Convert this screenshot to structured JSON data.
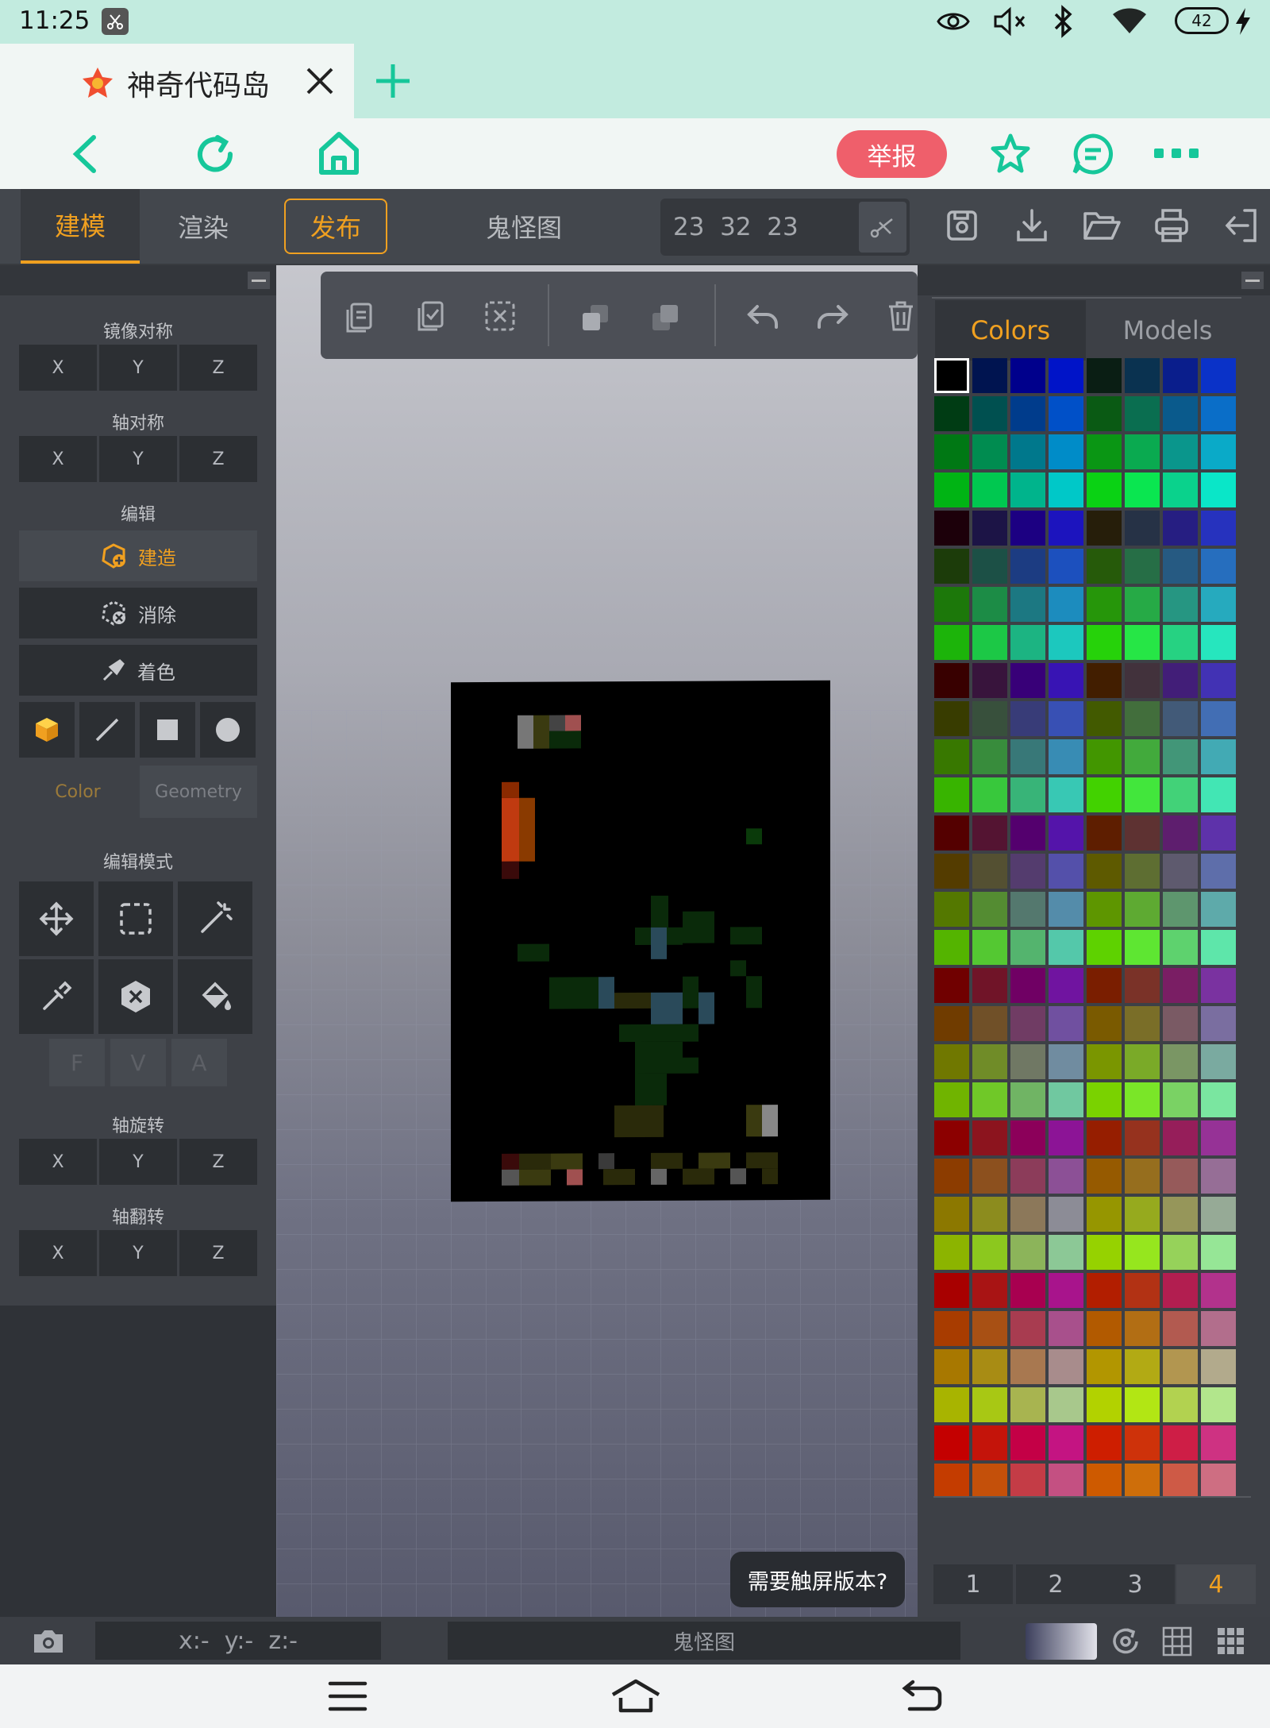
{
  "status_bar": {
    "time": "11:25",
    "battery": "42"
  },
  "browser": {
    "tab_title": "神奇代码岛",
    "report_label": "举报"
  },
  "toolbar": {
    "tabs": [
      {
        "label": "建模"
      },
      {
        "label": "渲染"
      },
      {
        "label": "发布"
      }
    ],
    "active_tab": "建模",
    "project_name": "鬼怪图",
    "dimensions": "23  32  23"
  },
  "left_panel": {
    "mirror_title": "镜像对称",
    "axis_sym_title": "轴对称",
    "edit_title": "编辑",
    "build_label": "建造",
    "erase_label": "消除",
    "paint_label": "着色",
    "color_tab": "Color",
    "geometry_tab": "Geometry",
    "edit_mode_title": "编辑模式",
    "fva": [
      "F",
      "V",
      "A"
    ],
    "rotate_title": "轴旋转",
    "flip_title": "轴翻转",
    "axes": [
      "X",
      "Y",
      "Z"
    ]
  },
  "right_panel": {
    "colors_tab": "Colors",
    "models_tab": "Models",
    "pages": [
      "1",
      "2",
      "3",
      "4"
    ],
    "active_page": "4"
  },
  "bottom_bar": {
    "coords": "x:-  y:-  z:-",
    "project_name": "鬼怪图"
  },
  "toast": "需要触屏版本?",
  "theme": {
    "accent": "#f0a020",
    "report": "#ef5f6b",
    "browser_green": "#16c79a"
  }
}
